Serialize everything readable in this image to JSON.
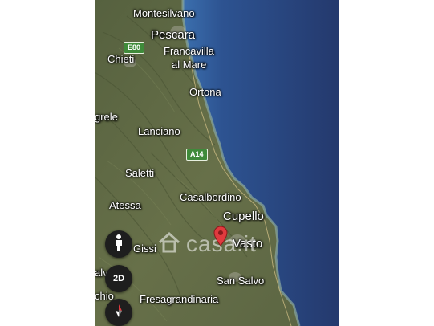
{
  "colors": {
    "sea_deep": "#27437a",
    "sea_coast": "#3a6aa8",
    "land": "#5c6645",
    "road_shield": "#3f8a3a",
    "pin": "#e03a3e"
  },
  "places": {
    "montesilvano": "Montesilvano",
    "pescara": "Pescara",
    "chieti": "Chieti",
    "francavilla": "Francavilla",
    "al_mare": "al Mare",
    "ortona": "Ortona",
    "grele": "grele",
    "lanciano": "Lanciano",
    "saletti": "Saletti",
    "atessa": "Atessa",
    "casalbordino": "Casalbordino",
    "cupello": "Cupello",
    "vasto": "Vasto",
    "gissi": "Gissi",
    "san_salvo": "San Salvo",
    "fresagrandinaria": "Fresagrandinaria",
    "alv": "alv",
    "chio": "chio"
  },
  "roads": {
    "e80": "E80",
    "a14": "A14"
  },
  "controls": {
    "street_view_icon": "pegman-icon",
    "view_mode": "2D",
    "compass_icon": "compass-icon"
  },
  "watermark": {
    "text": "casa.it",
    "icon": "house-logo-icon"
  }
}
